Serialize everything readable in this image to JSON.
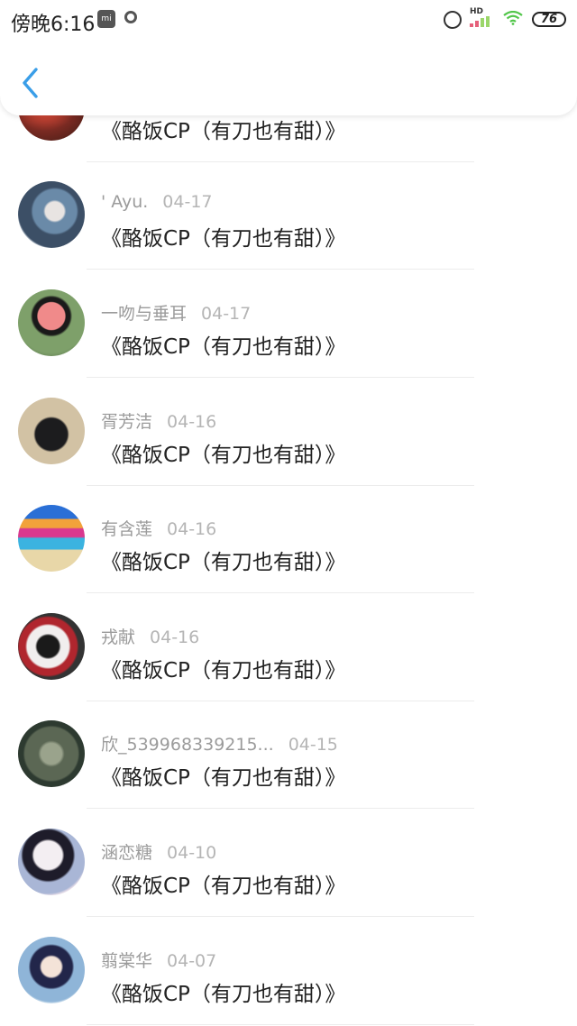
{
  "status_bar": {
    "time": "傍晚6:16",
    "mi_icon_text": "mi",
    "hd": "HD",
    "battery": "76"
  },
  "header": {
    "back_icon": "chevron-left-icon"
  },
  "colors": {
    "accent": "#3a9ee8",
    "username": "#9b9b9b",
    "date": "#b5b5b5",
    "title": "#222222",
    "divider": "#ececec"
  },
  "items": [
    {
      "name": "",
      "date": "",
      "title": "《酪饭CP（有刀也有甜）》"
    },
    {
      "name": "' Ayu.",
      "date": "04-17",
      "title": "《酪饭CP（有刀也有甜）》"
    },
    {
      "name": "一吻与垂耳",
      "date": "04-17",
      "title": "《酪饭CP（有刀也有甜）》"
    },
    {
      "name": "胥芳洁",
      "date": "04-16",
      "title": "《酪饭CP（有刀也有甜）》"
    },
    {
      "name": "有含莲",
      "date": "04-16",
      "title": "《酪饭CP（有刀也有甜）》"
    },
    {
      "name": "戎献",
      "date": "04-16",
      "title": "《酪饭CP（有刀也有甜）》"
    },
    {
      "name": "欣_539968339215...",
      "date": "04-15",
      "title": "《酪饭CP（有刀也有甜）》"
    },
    {
      "name": "涵恋糖",
      "date": "04-10",
      "title": "《酪饭CP（有刀也有甜）》"
    },
    {
      "name": "翦棠华",
      "date": "04-07",
      "title": "《酪饭CP（有刀也有甜）》"
    }
  ]
}
